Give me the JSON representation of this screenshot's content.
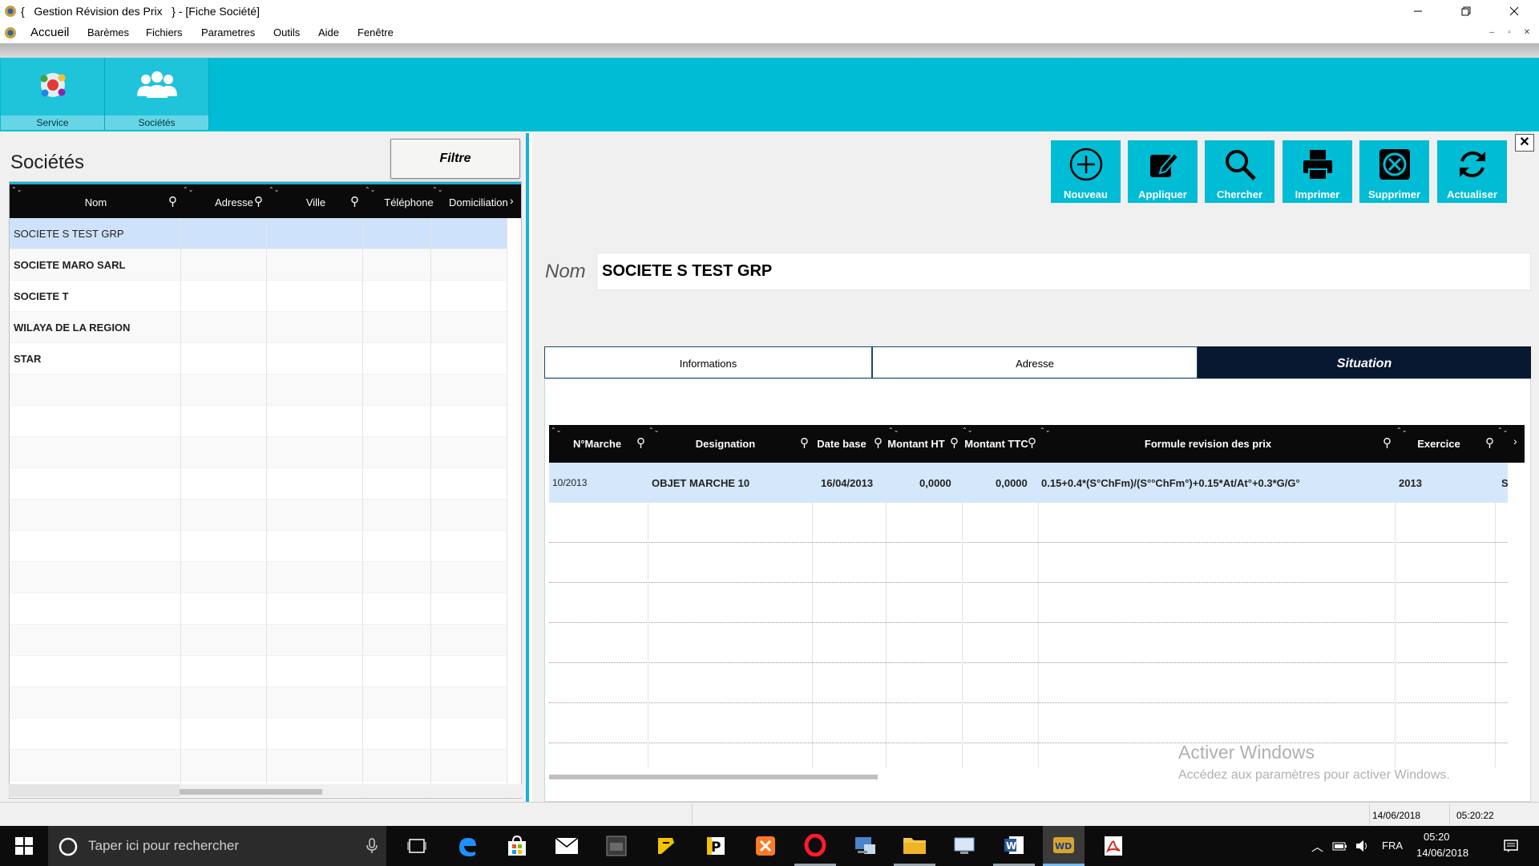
{
  "window": {
    "title": "{   Gestion Révision des Prix   } - [Fiche Société]"
  },
  "menu": {
    "items": [
      "Accueil",
      "Barèmes",
      "Fichiers",
      "Parametres",
      "Outils",
      "Aide",
      "Fenêtre"
    ]
  },
  "ribbon": {
    "buttons": [
      {
        "label": "Service",
        "icon": "service-molecule-icon"
      },
      {
        "label": "Sociétés",
        "icon": "users-group-icon"
      }
    ]
  },
  "societes_panel": {
    "title": "Sociétés",
    "filter_label": "Filtre",
    "columns": [
      "Nom",
      "Adresse",
      "Ville",
      "Téléphone",
      "Domiciliation"
    ],
    "rows": [
      "SOCIETE S TEST GRP",
      "SOCIETE MARO SARL",
      "SOCIETE T",
      "WILAYA DE LA REGION",
      "STAR"
    ],
    "selected_row": 0
  },
  "toolbar": {
    "buttons": [
      {
        "label": "Nouveau",
        "icon": "plus-circle-icon"
      },
      {
        "label": "Appliquer",
        "icon": "edit-icon"
      },
      {
        "label": "Chercher",
        "icon": "search-icon"
      },
      {
        "label": "Imprimer",
        "icon": "printer-icon"
      },
      {
        "label": "Supprimer",
        "icon": "delete-icon"
      },
      {
        "label": "Actualiser",
        "icon": "refresh-icon"
      }
    ]
  },
  "fiche": {
    "nom_label": "Nom",
    "nom_value": "SOCIETE S TEST GRP",
    "tabs": [
      "Informations",
      "Adresse",
      "Situation"
    ],
    "active_tab": "Situation"
  },
  "situation_grid": {
    "columns": [
      "N°Marche",
      "Designation",
      "Date base",
      "Montant HT",
      "Montant TTC",
      "Formule revision des prix",
      "Exercice"
    ],
    "rows": [
      {
        "n_marche": "10/2013",
        "designation": "OBJET MARCHE 10",
        "date_base": "16/04/2013",
        "montant_ht": "0,0000",
        "montant_ttc": "0,0000",
        "formule": "0.15+0.4*(S°ChFm)/(S°°ChFm°)+0.15*At/At°+0.3*G/G°",
        "exercice": "2013",
        "extra": "S"
      }
    ]
  },
  "watermark": {
    "line1": "Activer Windows",
    "line2": "Accédez aux paramètres pour activer Windows."
  },
  "statusbar": {
    "date": "14/06/2018",
    "time": "05:20:22"
  },
  "taskbar": {
    "search_placeholder": "Taper ici pour rechercher",
    "language": "FRA",
    "clock_time": "05:20",
    "clock_date": "14/06/2018"
  },
  "colors": {
    "accent": "#00bcd4",
    "header_dark": "#0a0a0a",
    "selected_row": "#cfe2fb",
    "active_tab": "#071830"
  }
}
